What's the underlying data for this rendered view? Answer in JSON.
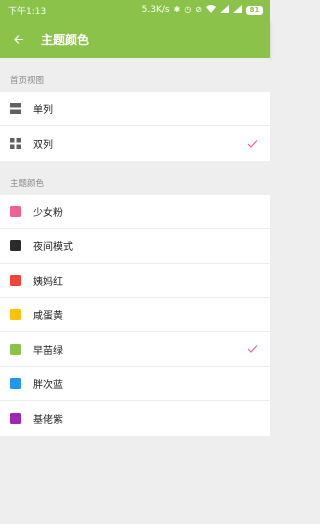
{
  "status_bar": {
    "time": "下午1:13",
    "net_speed": "5.3K/s",
    "battery": "81"
  },
  "app_bar": {
    "title": "主题颜色"
  },
  "home_view": {
    "section_title": "首页视图",
    "options": [
      {
        "label": "单列",
        "icon": "single-column-icon",
        "selected": false
      },
      {
        "label": "双列",
        "icon": "double-column-icon",
        "selected": true
      }
    ]
  },
  "theme_color": {
    "section_title": "主题颜色",
    "options": [
      {
        "label": "少女粉",
        "color": "#f06292",
        "selected": false
      },
      {
        "label": "夜间模式",
        "color": "#2b2b2b",
        "selected": false
      },
      {
        "label": "姨妈红",
        "color": "#f44336",
        "selected": false
      },
      {
        "label": "咸蛋黄",
        "color": "#ffc107",
        "selected": false
      },
      {
        "label": "早苗绿",
        "color": "#8bc34a",
        "selected": true
      },
      {
        "label": "胖次蓝",
        "color": "#2196f3",
        "selected": false
      },
      {
        "label": "基佬紫",
        "color": "#9c27b0",
        "selected": false
      }
    ]
  },
  "colors": {
    "accent": "#8bc34a",
    "check_mark": "#f06292"
  }
}
